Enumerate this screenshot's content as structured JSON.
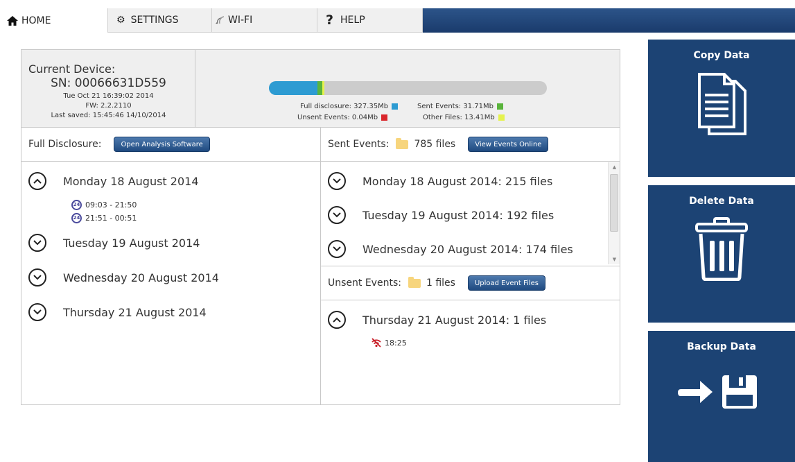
{
  "tabs": [
    {
      "label": "HOME",
      "icon": "home-icon"
    },
    {
      "label": "SETTINGS",
      "icon": "gear-icon"
    },
    {
      "label": "WI-FI",
      "icon": "wifi-icon"
    },
    {
      "label": "HELP",
      "icon": "question-icon"
    }
  ],
  "device": {
    "title": "Current Device:",
    "sn": "SN: 00066631D559",
    "datetime": "Tue Oct 21 16:39:02 2014",
    "fw": "FW: 2.2.2110",
    "last_saved": "Last saved: 15:45:46 14/10/2014"
  },
  "storage": {
    "full_disclosure": {
      "label": "Full disclosure: 327.35Mb",
      "value_mb": 327.35,
      "color": "#2d9bd2"
    },
    "sent_events": {
      "label": "Sent Events: 31.71Mb",
      "value_mb": 31.71,
      "color": "#5ab43c"
    },
    "unsent_events": {
      "label": "Unsent Events: 0.04Mb",
      "value_mb": 0.04,
      "color": "#d9262b"
    },
    "other_files": {
      "label": "Other Files: 13.41Mb",
      "value_mb": 13.41,
      "color": "#e5f24e"
    },
    "bar_fill_fraction": 0.2
  },
  "full_disclosure": {
    "label": "Full Disclosure:",
    "button": "Open Analysis Software",
    "days": [
      {
        "label": "Monday 18 August 2014",
        "expanded": true,
        "sessions": [
          "09:03 - 21:50",
          "21:51 - 00:51"
        ],
        "session_badge": "24"
      },
      {
        "label": "Tuesday 19 August 2014",
        "expanded": false
      },
      {
        "label": "Wednesday 20 August 2014",
        "expanded": false
      },
      {
        "label": "Thursday 21 August 2014",
        "expanded": false
      }
    ]
  },
  "sent_events": {
    "label": "Sent Events:",
    "count": "785 files",
    "button": "View Events Online",
    "days": [
      {
        "label": "Monday 18 August 2014:  215 files"
      },
      {
        "label": "Tuesday 19 August 2014:  192 files"
      },
      {
        "label": "Wednesday 20 August 2014:  174 files"
      }
    ]
  },
  "unsent_events": {
    "label": "Unsent Events:",
    "count": "1 files",
    "button": "Upload Event Files",
    "days": [
      {
        "label": "Thursday 21 August 2014:  1 files",
        "expanded": true,
        "events": [
          "18:25"
        ]
      }
    ]
  },
  "actions": {
    "copy": "Copy Data",
    "delete": "Delete Data",
    "backup": "Backup Data"
  }
}
